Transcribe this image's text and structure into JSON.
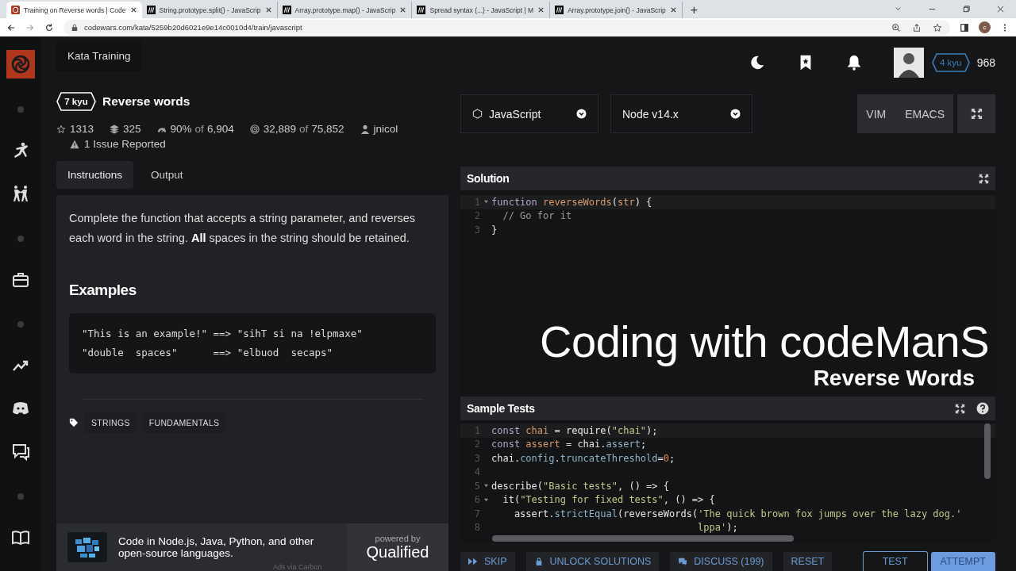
{
  "browser": {
    "tabs": [
      {
        "title": "Training on Reverse words | Code",
        "selected": true
      },
      {
        "title": "String.prototype.split() - JavaScrip",
        "selected": false
      },
      {
        "title": "Array.prototype.map() - JavaScrip",
        "selected": false
      },
      {
        "title": "Spread syntax (...) - JavaScript | M",
        "selected": false
      },
      {
        "title": "Array.prototype.join() - JavaScrip",
        "selected": false
      }
    ],
    "new_tab": "+",
    "url": "codewars.com/kata/5259b20d6021e9e14c0010d4/train/javascript",
    "profile": "c"
  },
  "sidebar": {
    "items": [
      {
        "kind": "logo"
      },
      {
        "kind": "dot"
      },
      {
        "kind": "kick"
      },
      {
        "kind": "fight"
      },
      {
        "kind": "dot"
      },
      {
        "kind": "briefcase"
      },
      {
        "kind": "dot"
      },
      {
        "kind": "trend"
      },
      {
        "kind": "discord"
      },
      {
        "kind": "chat"
      },
      {
        "kind": "dot"
      },
      {
        "kind": "book"
      }
    ]
  },
  "header": {
    "title": "Kata Training",
    "rank": "4 kyu",
    "honor": "968"
  },
  "kata": {
    "rank": "7 kyu",
    "title": "Reverse words",
    "stats": [
      {
        "kind": "star",
        "value": "1313"
      },
      {
        "kind": "stack",
        "value": "325"
      },
      {
        "kind": "gauge",
        "value": "90%",
        "of": "of",
        "total": "6,904"
      },
      {
        "kind": "target",
        "value": "32,889",
        "of": "of",
        "total": "75,852"
      },
      {
        "kind": "user",
        "value": "jnicol"
      }
    ],
    "issues": "1 Issue Reported"
  },
  "tabs": [
    {
      "label": "Instructions",
      "selected": true
    },
    {
      "label": "Output",
      "selected": false
    }
  ],
  "instructions": {
    "text": "Complete the function that accepts a string parameter, and reverses each word in the string. **All** spaces in the string should be retained.",
    "examples_heading": "Examples",
    "examples": [
      "\"This is an example!\" ==> \"sihT si na !elpmaxe\"",
      "\"double  spaces\"      ==> \"elbuod  secaps\""
    ],
    "tags": [
      "STRINGS",
      "FUNDAMENTALS"
    ]
  },
  "ad": {
    "text": "Code in Node.js, Java, Python, and other open-source languages.",
    "powered_by": "powered by",
    "brand": "Qualified",
    "via": "Ads via Carbon"
  },
  "selectors": [
    {
      "label": "JavaScript"
    },
    {
      "label": "Node v14.x"
    }
  ],
  "modes": [
    "VIM",
    "EMACS"
  ],
  "solution": {
    "title": "Solution",
    "lines": [
      {
        "n": "1",
        "fold": true,
        "tokens": [
          {
            "t": "function ",
            "kind": "keyword"
          },
          {
            "t": "reverseWords",
            "kind": "name"
          },
          {
            "t": "(",
            "kind": "plain"
          },
          {
            "t": "str",
            "kind": "name"
          },
          {
            "t": ") {",
            "kind": "plain"
          }
        ]
      },
      {
        "n": "2",
        "fold": false,
        "tokens": [
          {
            "t": "  // Go for it",
            "kind": "comment"
          }
        ]
      },
      {
        "n": "3",
        "fold": false,
        "tokens": [
          {
            "t": "}",
            "kind": "plain"
          }
        ]
      }
    ]
  },
  "overlay": {
    "title": "Coding with codeManS",
    "subtitle": "Reverse Words"
  },
  "tests": {
    "title": "Sample Tests",
    "lines": [
      {
        "n": "1",
        "fold": false,
        "tokens": [
          {
            "t": "const ",
            "kind": "keyword"
          },
          {
            "t": "chai",
            "kind": "name"
          },
          {
            "t": " = require(",
            "kind": "plain"
          },
          {
            "t": "\"chai\"",
            "kind": "string"
          },
          {
            "t": ");",
            "kind": "plain"
          }
        ]
      },
      {
        "n": "2",
        "fold": false,
        "tokens": [
          {
            "t": "const ",
            "kind": "keyword"
          },
          {
            "t": "assert",
            "kind": "name"
          },
          {
            "t": " = chai.",
            "kind": "plain"
          },
          {
            "t": "assert",
            "kind": "property"
          },
          {
            "t": ";",
            "kind": "plain"
          }
        ]
      },
      {
        "n": "3",
        "fold": false,
        "tokens": [
          {
            "t": "chai.",
            "kind": "plain"
          },
          {
            "t": "config",
            "kind": "property"
          },
          {
            "t": ".",
            "kind": "plain"
          },
          {
            "t": "truncateThreshold",
            "kind": "property"
          },
          {
            "t": "=",
            "kind": "plain"
          },
          {
            "t": "0",
            "kind": "number"
          },
          {
            "t": ";",
            "kind": "plain"
          }
        ]
      },
      {
        "n": "4",
        "fold": false
      },
      {
        "n": "5",
        "fold": true,
        "tokens": [
          {
            "t": "describe(",
            "kind": "plain"
          },
          {
            "t": "\"Basic tests\"",
            "kind": "string"
          },
          {
            "t": ", () => {",
            "kind": "plain"
          }
        ]
      },
      {
        "n": "6",
        "fold": true,
        "tokens": [
          {
            "t": "  it(",
            "kind": "plain"
          },
          {
            "t": "\"Testing for fixed tests\"",
            "kind": "string"
          },
          {
            "t": ", () => {",
            "kind": "plain"
          }
        ]
      },
      {
        "n": "7",
        "fold": false,
        "tokens": [
          {
            "t": "    assert.",
            "kind": "plain"
          },
          {
            "t": "strictEqual",
            "kind": "property"
          },
          {
            "t": "(reverseWords(",
            "kind": "plain"
          },
          {
            "t": "'The quick brown fox jumps over the lazy dog.'",
            "kind": "string"
          }
        ]
      },
      {
        "n": "8",
        "fold": false,
        "tokens": [
          {
            "t": "                                    lppa'",
            "kind": "string"
          },
          {
            "t": ");",
            "kind": "plain"
          }
        ]
      }
    ]
  },
  "actions": [
    {
      "label": "SKIP",
      "kind": "plain"
    },
    {
      "label": "UNLOCK SOLUTIONS",
      "kind": "plain"
    },
    {
      "label": "DISCUSS (199)",
      "kind": "plain"
    },
    {
      "label": "RESET",
      "kind": "plain"
    },
    {
      "label": "TEST",
      "kind": "outline"
    },
    {
      "label": "ATTEMPT",
      "kind": "primary"
    }
  ]
}
